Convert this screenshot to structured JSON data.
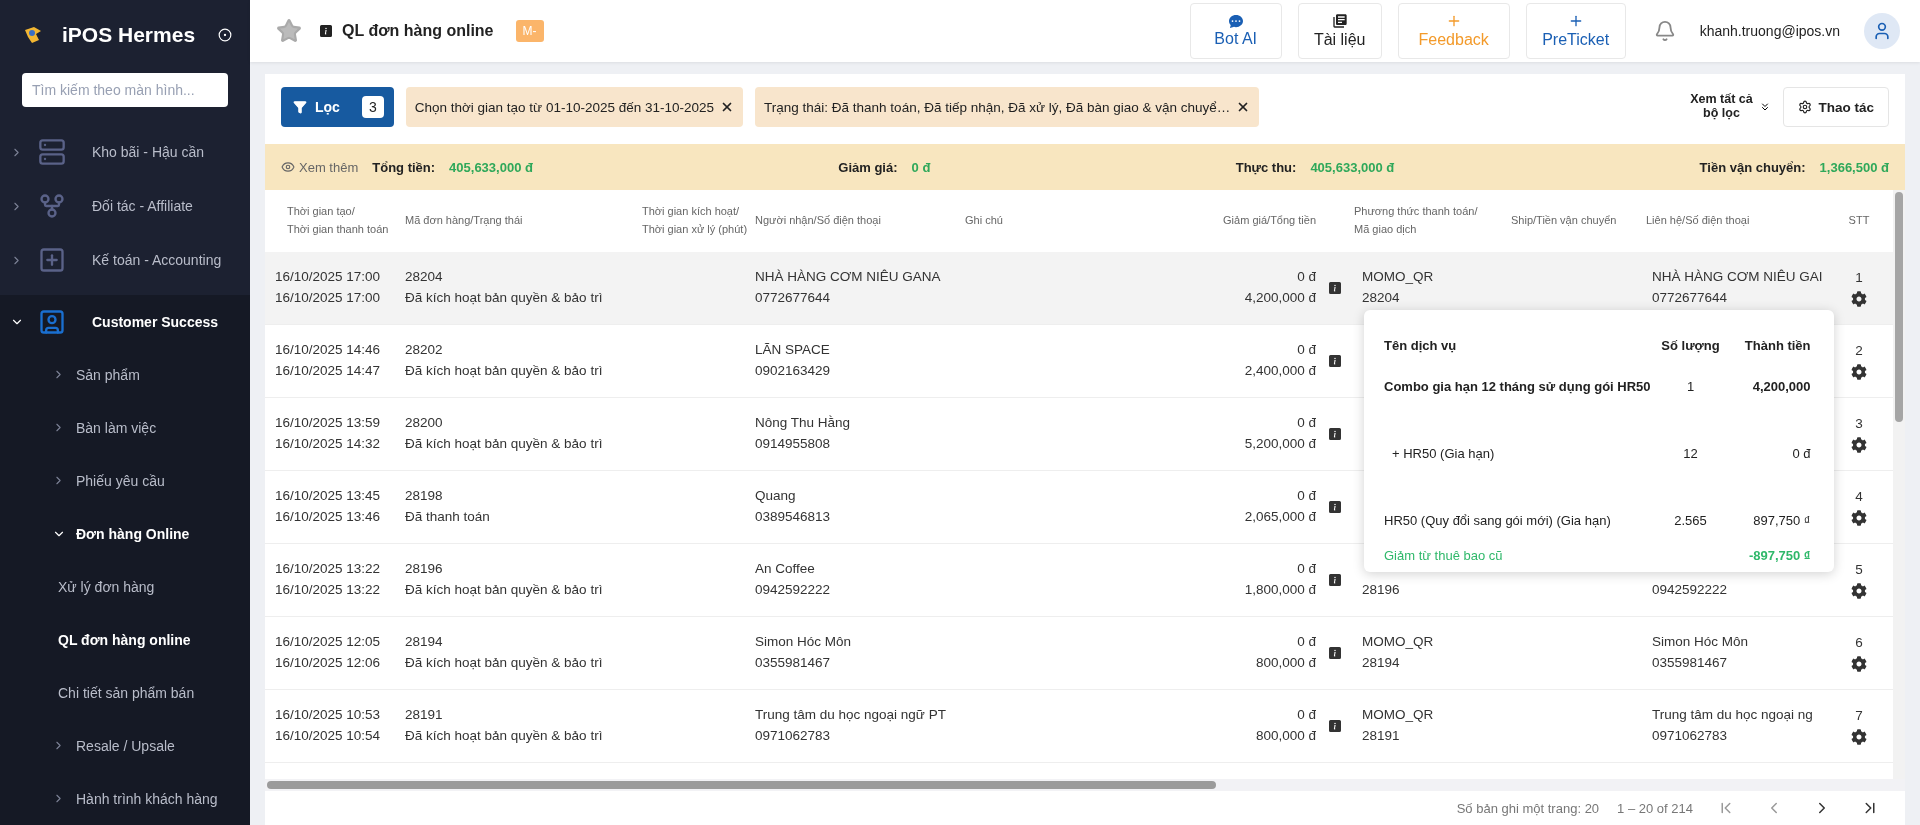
{
  "sidebar": {
    "brand": "iPOS Hermes",
    "search": {
      "placeholder": "Tìm kiếm theo màn hình..."
    },
    "items": [
      {
        "label": "Kho bãi - Hậu cần",
        "kind": "server",
        "expanded": false,
        "selected": false
      },
      {
        "label": "Đối tác - Affiliate",
        "kind": "affiliate",
        "expanded": false,
        "selected": false
      },
      {
        "label": "Kế toán - Accounting",
        "kind": "accounting",
        "expanded": false,
        "selected": false
      },
      {
        "label": "Customer Success",
        "kind": "customer",
        "expanded": true,
        "selected": true,
        "children": [
          {
            "label": "Sản phẩm",
            "expanded": false,
            "selected": false
          },
          {
            "label": "Bàn làm việc",
            "expanded": false,
            "selected": false
          },
          {
            "label": "Phiếu yêu cầu",
            "expanded": false,
            "selected": false
          },
          {
            "label": "Đơn hàng Online",
            "expanded": true,
            "selected": true,
            "children": [
              {
                "label": "Xử lý đơn hàng",
                "selected": false
              },
              {
                "label": "QL đơn hàng online",
                "selected": true
              },
              {
                "label": "Chi tiết sản phẩm bán",
                "selected": false
              }
            ]
          },
          {
            "label": "Resale / Upsale",
            "expanded": false,
            "selected": false
          },
          {
            "label": "Hành trình khách hàng",
            "expanded": false,
            "selected": false
          }
        ]
      }
    ]
  },
  "header": {
    "title": "QL đơn hàng online",
    "badge": "M-",
    "actions": [
      {
        "label": "Bot AI",
        "kind": "chat"
      },
      {
        "label": "Tài liệu",
        "kind": "docs"
      },
      {
        "label": "Feedback",
        "kind": "feedback"
      },
      {
        "label": "PreTicket",
        "kind": "ticket"
      }
    ],
    "user": "khanh.truong@ipos.vn"
  },
  "filters": {
    "button": {
      "label": "Lọc",
      "count": "3"
    },
    "chips": [
      "Chọn thời gian tạo từ 01-10-2025 đến 31-10-2025",
      "Trạng thái: Đã thanh toán, Đã tiếp nhận, Đã xử lý, Đã bàn giao & vận chuyể…"
    ],
    "show_all": "Xem tất cả bộ lọc",
    "actions": "Thao tác"
  },
  "summary": {
    "toggle": "Xem thêm",
    "items": [
      {
        "label": "Tổng tiền:",
        "value": "405,633,000 đ"
      },
      {
        "label": "Giảm giá:",
        "value": "0 đ"
      },
      {
        "label": "Thực thu:",
        "value": "405,633,000 đ"
      },
      {
        "label": "Tiền vận chuyển:",
        "value": "1,366,500 đ"
      }
    ]
  },
  "table": {
    "columns": [
      [
        "Thời gian tạo/",
        "Thời gian thanh toán"
      ],
      [
        "Mã đơn hàng/Trạng thái"
      ],
      [
        "Thời gian kích hoạt/",
        "Thời gian xử lý (phút)"
      ],
      [
        "Người nhận/Số điện thoại"
      ],
      [
        "Ghi chú"
      ],
      [
        "Giảm giá/Tổng tiền"
      ],
      [],
      [
        "Phương thức thanh toán/",
        "Mã giao dịch"
      ],
      [
        "Ship/Tiền vận chuyển"
      ],
      [
        "Liên hệ/Số điện thoại"
      ],
      [
        "STT"
      ]
    ],
    "rows": [
      {
        "selected": true,
        "created": "16/10/2025 17:00",
        "paid": "16/10/2025 17:00",
        "order_id": "28204",
        "status": "Đã kích hoạt bản quyền & bảo trì",
        "recipient": "NHÀ HÀNG CƠM NIÊU GANA",
        "phone": "0772677644",
        "discount": "0 đ",
        "total": "4,200,000 đ",
        "payment_method": "MOMO_QR",
        "transaction_id": "28204",
        "contact": "NHÀ HÀNG CƠM NIÊU GAI",
        "contact_phone": "0772677644",
        "stt": "1"
      },
      {
        "selected": false,
        "created": "16/10/2025 14:46",
        "paid": "16/10/2025 14:47",
        "order_id": "28202",
        "status": "Đã kích hoạt bản quyền & bảo trì",
        "recipient": "LÃN SPACE",
        "phone": "0902163429",
        "discount": "0 đ",
        "total": "2,400,000 đ",
        "stt": "2"
      },
      {
        "selected": false,
        "created": "16/10/2025 13:59",
        "paid": "16/10/2025 14:32",
        "order_id": "28200",
        "status": "Đã kích hoạt bản quyền & bảo trì",
        "recipient": "Nông Thu Hằng",
        "phone": "0914955808",
        "discount": "0 đ",
        "total": "5,200,000 đ",
        "stt": "3"
      },
      {
        "selected": false,
        "created": "16/10/2025 13:45",
        "paid": "16/10/2025 13:46",
        "order_id": "28198",
        "status": "Đã thanh toán",
        "recipient": "Quang",
        "phone": "0389546813",
        "discount": "0 đ",
        "total": "2,065,000 đ",
        "stt": "4"
      },
      {
        "selected": false,
        "created": "16/10/2025 13:22",
        "paid": "16/10/2025 13:22",
        "order_id": "28196",
        "status": "Đã kích hoạt bản quyền & bảo trì",
        "recipient": "An Coffee",
        "phone": "0942592222",
        "discount": "0 đ",
        "total": "1,800,000 đ",
        "transaction_id": "28196",
        "contact_phone": "0942592222",
        "stt": "5"
      },
      {
        "selected": false,
        "created": "16/10/2025 12:05",
        "paid": "16/10/2025 12:06",
        "order_id": "28194",
        "status": "Đã kích hoạt bản quyền & bảo trì",
        "recipient": "Simon Hóc Môn",
        "phone": "0355981467",
        "discount": "0 đ",
        "total": "800,000 đ",
        "payment_method": "MOMO_QR",
        "transaction_id": "28194",
        "contact": "Simon Hóc Môn",
        "contact_phone": "0355981467",
        "stt": "6"
      },
      {
        "selected": false,
        "created": "16/10/2025 10:53",
        "paid": "16/10/2025 10:54",
        "order_id": "28191",
        "status": "Đã kích hoạt bản quyền & bảo trì",
        "recipient": "Trung tâm du học ngoại ngữ PT",
        "phone": "0971062783",
        "discount": "0 đ",
        "total": "800,000 đ",
        "payment_method": "MOMO_QR",
        "transaction_id": "28191",
        "contact": "Trung tâm du học ngoại ng",
        "contact_phone": "0971062783",
        "stt": "7"
      }
    ]
  },
  "popover": {
    "columns": [
      "Tên dịch vụ",
      "Số lượng",
      "Thành tiền"
    ],
    "lines": [
      {
        "kind": "main",
        "name": "Combo gia hạn 12 tháng sử dụng gói HR50",
        "qty": "1",
        "amount": "4,200,000"
      },
      {
        "kind": "sub",
        "name": "+ HR50 (Gia hạn)",
        "qty": "12",
        "amount": "0 đ"
      },
      {
        "kind": "normal",
        "name": "HR50 (Quy đổi sang gói mới) (Gia hạn)",
        "qty": "2.565",
        "amount": "897,750 ₫"
      },
      {
        "kind": "discount",
        "name": "Giảm từ thuê bao cũ",
        "amount": "-897,750 ₫"
      }
    ]
  },
  "pagination": {
    "page_size_label": "Số bản ghi một trang:",
    "page_size": "20",
    "range": "1 – 20 of 214"
  }
}
